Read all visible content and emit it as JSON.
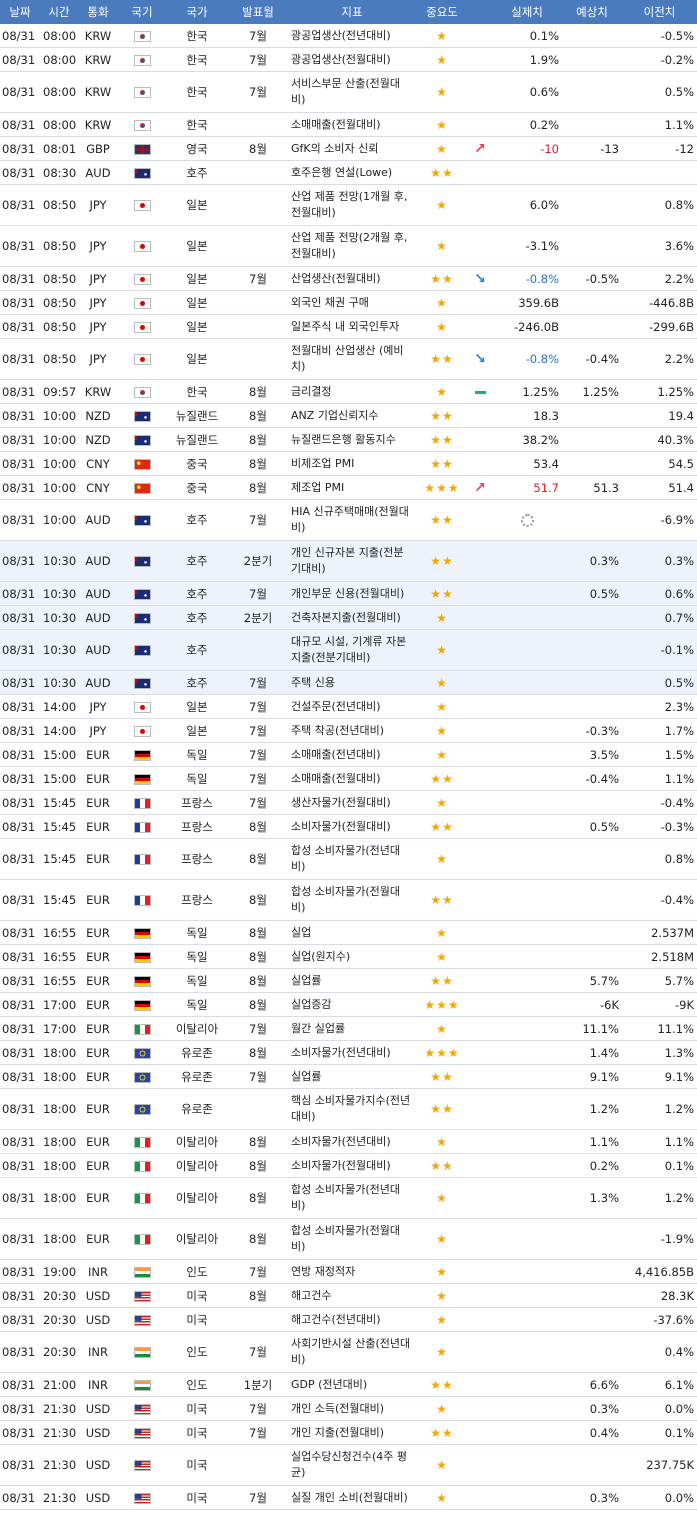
{
  "header": [
    "날짜",
    "시간",
    "통화",
    "국기",
    "국가",
    "발표월",
    "지표",
    "중요도",
    "",
    "실제치",
    "예상치",
    "이전치"
  ],
  "rows": [
    {
      "date": "08/31",
      "time": "08:00",
      "cur": "KRW",
      "flag": "kr",
      "country": "한국",
      "period": "7월",
      "ind": "광공업생산(전년대비)",
      "imp": 1,
      "arrow": "",
      "act": "0.1%",
      "act_dir": "",
      "fc": "",
      "prev": "-0.5%",
      "tall": false
    },
    {
      "date": "08/31",
      "time": "08:00",
      "cur": "KRW",
      "flag": "kr",
      "country": "한국",
      "period": "7월",
      "ind": "광공업생산(전월대비)",
      "imp": 1,
      "arrow": "",
      "act": "1.9%",
      "act_dir": "",
      "fc": "",
      "prev": "-0.2%",
      "tall": false
    },
    {
      "date": "08/31",
      "time": "08:00",
      "cur": "KRW",
      "flag": "kr",
      "country": "한국",
      "period": "7월",
      "ind": "서비스부문 산출(전월대비)",
      "imp": 1,
      "arrow": "",
      "act": "0.6%",
      "act_dir": "",
      "fc": "",
      "prev": "0.5%",
      "tall": true
    },
    {
      "date": "08/31",
      "time": "08:00",
      "cur": "KRW",
      "flag": "kr",
      "country": "한국",
      "period": "",
      "ind": "소매매출(전월대비)",
      "imp": 1,
      "arrow": "",
      "act": "0.2%",
      "act_dir": "",
      "fc": "",
      "prev": "1.1%",
      "tall": false
    },
    {
      "date": "08/31",
      "time": "08:01",
      "cur": "GBP",
      "flag": "gb",
      "country": "영국",
      "period": "8월",
      "ind": "GfK의 소비자 신뢰",
      "imp": 1,
      "arrow": "up",
      "act": "-10",
      "act_dir": "up",
      "fc": "-13",
      "prev": "-12",
      "tall": false
    },
    {
      "date": "08/31",
      "time": "08:30",
      "cur": "AUD",
      "flag": "au",
      "country": "호주",
      "period": "",
      "ind": "호주은행 연설(Lowe)",
      "imp": 2,
      "arrow": "",
      "act": "",
      "act_dir": "",
      "fc": "",
      "prev": "",
      "tall": false
    },
    {
      "date": "08/31",
      "time": "08:50",
      "cur": "JPY",
      "flag": "jp",
      "country": "일본",
      "period": "",
      "ind": "산업 제품 전망(1개월 후, 전월대비)",
      "imp": 1,
      "arrow": "",
      "act": "6.0%",
      "act_dir": "",
      "fc": "",
      "prev": "0.8%",
      "tall": true
    },
    {
      "date": "08/31",
      "time": "08:50",
      "cur": "JPY",
      "flag": "jp",
      "country": "일본",
      "period": "",
      "ind": "산업 제품 전망(2개월 후, 전월대비)",
      "imp": 1,
      "arrow": "",
      "act": "-3.1%",
      "act_dir": "",
      "fc": "",
      "prev": "3.6%",
      "tall": true
    },
    {
      "date": "08/31",
      "time": "08:50",
      "cur": "JPY",
      "flag": "jp",
      "country": "일본",
      "period": "7월",
      "ind": "산업생산(전월대비)",
      "imp": 2,
      "arrow": "down",
      "act": "-0.8%",
      "act_dir": "down",
      "fc": "-0.5%",
      "prev": "2.2%",
      "tall": false
    },
    {
      "date": "08/31",
      "time": "08:50",
      "cur": "JPY",
      "flag": "jp",
      "country": "일본",
      "period": "",
      "ind": "외국인 채권 구매",
      "imp": 1,
      "arrow": "",
      "act": "359.6B",
      "act_dir": "",
      "fc": "",
      "prev": "-446.8B",
      "tall": false
    },
    {
      "date": "08/31",
      "time": "08:50",
      "cur": "JPY",
      "flag": "jp",
      "country": "일본",
      "period": "",
      "ind": "일본주식 내 외국인투자",
      "imp": 1,
      "arrow": "",
      "act": "-246.0B",
      "act_dir": "",
      "fc": "",
      "prev": "-299.6B",
      "tall": false
    },
    {
      "date": "08/31",
      "time": "08:50",
      "cur": "JPY",
      "flag": "jp",
      "country": "일본",
      "period": "",
      "ind": "전월대비 산업생산 (예비치)",
      "imp": 2,
      "arrow": "down",
      "act": "-0.8%",
      "act_dir": "down",
      "fc": "-0.4%",
      "prev": "2.2%",
      "tall": true
    },
    {
      "date": "08/31",
      "time": "09:57",
      "cur": "KRW",
      "flag": "kr",
      "country": "한국",
      "period": "8월",
      "ind": "금리결정",
      "imp": 1,
      "arrow": "eq",
      "act": "1.25%",
      "act_dir": "",
      "fc": "1.25%",
      "prev": "1.25%",
      "tall": false
    },
    {
      "date": "08/31",
      "time": "10:00",
      "cur": "NZD",
      "flag": "nz",
      "country": "뉴질랜드",
      "period": "8월",
      "ind": "ANZ 기업신뢰지수",
      "imp": 2,
      "arrow": "",
      "act": "18.3",
      "act_dir": "",
      "fc": "",
      "prev": "19.4",
      "tall": false
    },
    {
      "date": "08/31",
      "time": "10:00",
      "cur": "NZD",
      "flag": "nz",
      "country": "뉴질랜드",
      "period": "8월",
      "ind": "뉴질랜드은행 활동지수",
      "imp": 2,
      "arrow": "",
      "act": "38.2%",
      "act_dir": "",
      "fc": "",
      "prev": "40.3%",
      "tall": false
    },
    {
      "date": "08/31",
      "time": "10:00",
      "cur": "CNY",
      "flag": "cn",
      "country": "중국",
      "period": "8월",
      "ind": "비제조업 PMI",
      "imp": 2,
      "arrow": "",
      "act": "53.4",
      "act_dir": "",
      "fc": "",
      "prev": "54.5",
      "tall": false
    },
    {
      "date": "08/31",
      "time": "10:00",
      "cur": "CNY",
      "flag": "cn",
      "country": "중국",
      "period": "8월",
      "ind": "제조업 PMI",
      "imp": 3,
      "arrow": "up",
      "act": "51.7",
      "act_dir": "up",
      "fc": "51.3",
      "prev": "51.4",
      "tall": false
    },
    {
      "date": "08/31",
      "time": "10:00",
      "cur": "AUD",
      "flag": "au",
      "country": "호주",
      "period": "7월",
      "ind": "HIA 신규주택매매(전월대비)",
      "imp": 2,
      "arrow": "",
      "act": "",
      "act_dir": "loading",
      "fc": "",
      "prev": "-6.9%",
      "tall": true
    },
    {
      "date": "08/31",
      "time": "10:30",
      "cur": "AUD",
      "flag": "au",
      "country": "호주",
      "period": "2분기",
      "ind": "개인 신규자본 지출(전분기대비)",
      "imp": 2,
      "arrow": "",
      "act": "",
      "act_dir": "",
      "fc": "0.3%",
      "prev": "0.3%",
      "tall": true,
      "hl": true
    },
    {
      "date": "08/31",
      "time": "10:30",
      "cur": "AUD",
      "flag": "au",
      "country": "호주",
      "period": "7월",
      "ind": "개인부문 신용(전월대비)",
      "imp": 2,
      "arrow": "",
      "act": "",
      "act_dir": "",
      "fc": "0.5%",
      "prev": "0.6%",
      "tall": false,
      "hl": true
    },
    {
      "date": "08/31",
      "time": "10:30",
      "cur": "AUD",
      "flag": "au",
      "country": "호주",
      "period": "2분기",
      "ind": "건축자본지출(전월대비)",
      "imp": 1,
      "arrow": "",
      "act": "",
      "act_dir": "",
      "fc": "",
      "prev": "0.7%",
      "tall": false,
      "hl": true
    },
    {
      "date": "08/31",
      "time": "10:30",
      "cur": "AUD",
      "flag": "au",
      "country": "호주",
      "period": "",
      "ind": "대규모 시설, 기계류 자본지출(전분기대비)",
      "imp": 1,
      "arrow": "",
      "act": "",
      "act_dir": "",
      "fc": "",
      "prev": "-0.1%",
      "tall": true,
      "hl": true
    },
    {
      "date": "08/31",
      "time": "10:30",
      "cur": "AUD",
      "flag": "au",
      "country": "호주",
      "period": "7월",
      "ind": "주택 신용",
      "imp": 1,
      "arrow": "",
      "act": "",
      "act_dir": "",
      "fc": "",
      "prev": "0.5%",
      "tall": false,
      "hl": true
    },
    {
      "date": "08/31",
      "time": "14:00",
      "cur": "JPY",
      "flag": "jp",
      "country": "일본",
      "period": "7월",
      "ind": "건설주문(전년대비)",
      "imp": 1,
      "arrow": "",
      "act": "",
      "act_dir": "",
      "fc": "",
      "prev": "2.3%",
      "tall": false
    },
    {
      "date": "08/31",
      "time": "14:00",
      "cur": "JPY",
      "flag": "jp",
      "country": "일본",
      "period": "7월",
      "ind": "주택 착공(전년대비)",
      "imp": 1,
      "arrow": "",
      "act": "",
      "act_dir": "",
      "fc": "-0.3%",
      "prev": "1.7%",
      "tall": false
    },
    {
      "date": "08/31",
      "time": "15:00",
      "cur": "EUR",
      "flag": "de",
      "country": "독일",
      "period": "7월",
      "ind": "소매매출(전년대비)",
      "imp": 1,
      "arrow": "",
      "act": "",
      "act_dir": "",
      "fc": "3.5%",
      "prev": "1.5%",
      "tall": false
    },
    {
      "date": "08/31",
      "time": "15:00",
      "cur": "EUR",
      "flag": "de",
      "country": "독일",
      "period": "7월",
      "ind": "소매매출(전월대비)",
      "imp": 2,
      "arrow": "",
      "act": "",
      "act_dir": "",
      "fc": "-0.4%",
      "prev": "1.1%",
      "tall": false
    },
    {
      "date": "08/31",
      "time": "15:45",
      "cur": "EUR",
      "flag": "fr",
      "country": "프랑스",
      "period": "7월",
      "ind": "생산자물가(전월대비)",
      "imp": 1,
      "arrow": "",
      "act": "",
      "act_dir": "",
      "fc": "",
      "prev": "-0.4%",
      "tall": false
    },
    {
      "date": "08/31",
      "time": "15:45",
      "cur": "EUR",
      "flag": "fr",
      "country": "프랑스",
      "period": "8월",
      "ind": "소비자물가(전월대비)",
      "imp": 2,
      "arrow": "",
      "act": "",
      "act_dir": "",
      "fc": "0.5%",
      "prev": "-0.3%",
      "tall": false
    },
    {
      "date": "08/31",
      "time": "15:45",
      "cur": "EUR",
      "flag": "fr",
      "country": "프랑스",
      "period": "8월",
      "ind": "합성 소비자물가(전년대비)",
      "imp": 1,
      "arrow": "",
      "act": "",
      "act_dir": "",
      "fc": "",
      "prev": "0.8%",
      "tall": true
    },
    {
      "date": "08/31",
      "time": "15:45",
      "cur": "EUR",
      "flag": "fr",
      "country": "프랑스",
      "period": "8월",
      "ind": "합성 소비자물가(전월대비)",
      "imp": 2,
      "arrow": "",
      "act": "",
      "act_dir": "",
      "fc": "",
      "prev": "-0.4%",
      "tall": true
    },
    {
      "date": "08/31",
      "time": "16:55",
      "cur": "EUR",
      "flag": "de",
      "country": "독일",
      "period": "8월",
      "ind": "실업",
      "imp": 1,
      "arrow": "",
      "act": "",
      "act_dir": "",
      "fc": "",
      "prev": "2.537M",
      "tall": false
    },
    {
      "date": "08/31",
      "time": "16:55",
      "cur": "EUR",
      "flag": "de",
      "country": "독일",
      "period": "8월",
      "ind": "실업(원지수)",
      "imp": 1,
      "arrow": "",
      "act": "",
      "act_dir": "",
      "fc": "",
      "prev": "2.518M",
      "tall": false
    },
    {
      "date": "08/31",
      "time": "16:55",
      "cur": "EUR",
      "flag": "de",
      "country": "독일",
      "period": "8월",
      "ind": "실업률",
      "imp": 2,
      "arrow": "",
      "act": "",
      "act_dir": "",
      "fc": "5.7%",
      "prev": "5.7%",
      "tall": false
    },
    {
      "date": "08/31",
      "time": "17:00",
      "cur": "EUR",
      "flag": "de",
      "country": "독일",
      "period": "8월",
      "ind": "실업증감",
      "imp": 3,
      "arrow": "",
      "act": "",
      "act_dir": "",
      "fc": "-6K",
      "prev": "-9K",
      "tall": false
    },
    {
      "date": "08/31",
      "time": "17:00",
      "cur": "EUR",
      "flag": "it",
      "country": "이탈리아",
      "period": "7월",
      "ind": "월간 실업률",
      "imp": 1,
      "arrow": "",
      "act": "",
      "act_dir": "",
      "fc": "11.1%",
      "prev": "11.1%",
      "tall": false
    },
    {
      "date": "08/31",
      "time": "18:00",
      "cur": "EUR",
      "flag": "eu",
      "country": "유로존",
      "period": "8월",
      "ind": "소비자물가(전년대비)",
      "imp": 3,
      "arrow": "",
      "act": "",
      "act_dir": "",
      "fc": "1.4%",
      "prev": "1.3%",
      "tall": false
    },
    {
      "date": "08/31",
      "time": "18:00",
      "cur": "EUR",
      "flag": "eu",
      "country": "유로존",
      "period": "7월",
      "ind": "실업률",
      "imp": 2,
      "arrow": "",
      "act": "",
      "act_dir": "",
      "fc": "9.1%",
      "prev": "9.1%",
      "tall": false
    },
    {
      "date": "08/31",
      "time": "18:00",
      "cur": "EUR",
      "flag": "eu",
      "country": "유로존",
      "period": "",
      "ind": "핵심 소비자물가지수(전년대비)",
      "imp": 2,
      "arrow": "",
      "act": "",
      "act_dir": "",
      "fc": "1.2%",
      "prev": "1.2%",
      "tall": true
    },
    {
      "date": "08/31",
      "time": "18:00",
      "cur": "EUR",
      "flag": "it",
      "country": "이탈리아",
      "period": "8월",
      "ind": "소비자물가(전년대비)",
      "imp": 1,
      "arrow": "",
      "act": "",
      "act_dir": "",
      "fc": "1.1%",
      "prev": "1.1%",
      "tall": false
    },
    {
      "date": "08/31",
      "time": "18:00",
      "cur": "EUR",
      "flag": "it",
      "country": "이탈리아",
      "period": "8월",
      "ind": "소비자물가(전월대비)",
      "imp": 2,
      "arrow": "",
      "act": "",
      "act_dir": "",
      "fc": "0.2%",
      "prev": "0.1%",
      "tall": false
    },
    {
      "date": "08/31",
      "time": "18:00",
      "cur": "EUR",
      "flag": "it",
      "country": "이탈리아",
      "period": "8월",
      "ind": "합성 소비자물가(전년대비)",
      "imp": 1,
      "arrow": "",
      "act": "",
      "act_dir": "",
      "fc": "1.3%",
      "prev": "1.2%",
      "tall": true
    },
    {
      "date": "08/31",
      "time": "18:00",
      "cur": "EUR",
      "flag": "it",
      "country": "이탈리아",
      "period": "8월",
      "ind": "합성 소비자물가(전월대비)",
      "imp": 1,
      "arrow": "",
      "act": "",
      "act_dir": "",
      "fc": "",
      "prev": "-1.9%",
      "tall": true
    },
    {
      "date": "08/31",
      "time": "19:00",
      "cur": "INR",
      "flag": "in",
      "country": "인도",
      "period": "7월",
      "ind": "연방 재정적자",
      "imp": 1,
      "arrow": "",
      "act": "",
      "act_dir": "",
      "fc": "",
      "prev": "4,416.85B",
      "tall": false
    },
    {
      "date": "08/31",
      "time": "20:30",
      "cur": "USD",
      "flag": "us",
      "country": "미국",
      "period": "8월",
      "ind": "해고건수",
      "imp": 1,
      "arrow": "",
      "act": "",
      "act_dir": "",
      "fc": "",
      "prev": "28.3K",
      "tall": false
    },
    {
      "date": "08/31",
      "time": "20:30",
      "cur": "USD",
      "flag": "us",
      "country": "미국",
      "period": "",
      "ind": "해고건수(전년대비)",
      "imp": 1,
      "arrow": "",
      "act": "",
      "act_dir": "",
      "fc": "",
      "prev": "-37.6%",
      "tall": false
    },
    {
      "date": "08/31",
      "time": "20:30",
      "cur": "INR",
      "flag": "in",
      "country": "인도",
      "period": "7월",
      "ind": "사회기반시설 산출(전년대비)",
      "imp": 1,
      "arrow": "",
      "act": "",
      "act_dir": "",
      "fc": "",
      "prev": "0.4%",
      "tall": true
    },
    {
      "date": "08/31",
      "time": "21:00",
      "cur": "INR",
      "flag": "in",
      "country": "인도",
      "period": "1분기",
      "ind": "GDP (전년대비)",
      "imp": 2,
      "arrow": "",
      "act": "",
      "act_dir": "",
      "fc": "6.6%",
      "prev": "6.1%",
      "tall": false
    },
    {
      "date": "08/31",
      "time": "21:30",
      "cur": "USD",
      "flag": "us",
      "country": "미국",
      "period": "7월",
      "ind": "개인 소득(전월대비)",
      "imp": 1,
      "arrow": "",
      "act": "",
      "act_dir": "",
      "fc": "0.3%",
      "prev": "0.0%",
      "tall": false
    },
    {
      "date": "08/31",
      "time": "21:30",
      "cur": "USD",
      "flag": "us",
      "country": "미국",
      "period": "7월",
      "ind": "개인 지출(전월대비)",
      "imp": 2,
      "arrow": "",
      "act": "",
      "act_dir": "",
      "fc": "0.4%",
      "prev": "0.1%",
      "tall": false
    },
    {
      "date": "08/31",
      "time": "21:30",
      "cur": "USD",
      "flag": "us",
      "country": "미국",
      "period": "",
      "ind": "실업수당신청건수(4주 평균)",
      "imp": 1,
      "arrow": "",
      "act": "",
      "act_dir": "",
      "fc": "",
      "prev": "237.75K",
      "tall": true
    },
    {
      "date": "08/31",
      "time": "21:30",
      "cur": "USD",
      "flag": "us",
      "country": "미국",
      "period": "7월",
      "ind": "실질 개인 소비(전월대비)",
      "imp": 1,
      "arrow": "",
      "act": "",
      "act_dir": "",
      "fc": "0.3%",
      "prev": "0.0%",
      "tall": false
    }
  ]
}
